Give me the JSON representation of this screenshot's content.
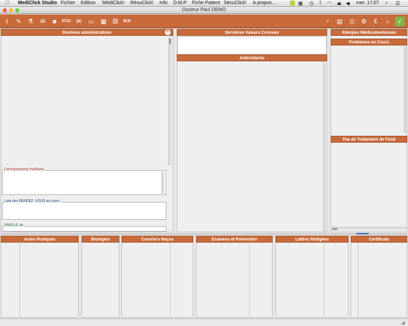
{
  "menubar": {
    "app_name": "MediClick Studio",
    "items": [
      "Fichier",
      "Edition",
      "MédiClick!",
      "RésuClick!",
      "Info",
      "D.M.P",
      "Fiche Patient",
      "SécuClick!",
      "A propos..."
    ],
    "clock": "mer. 17:07"
  },
  "window": {
    "title": "Docteur Paul DEMO"
  },
  "toolbar": {
    "atcd_label": "ATCD",
    "bcb_label": "BCB"
  },
  "left_panel": {
    "header": "Données administratives",
    "correspondants_label": "Correspondants Habituels",
    "rdv_label": "Liste des RENDEZ- VOUS en cours :",
    "famille_label": "FAMILLE de"
  },
  "middle_panel": {
    "dernieres_valeurs": "Dernières Valeurs Connues",
    "antecedents": "Antécédents"
  },
  "right_panel": {
    "allergies": "Allergies Médicamenteuses",
    "problemes": "Problèmes en Cours",
    "traitement": "Pas de Traitement de Fond"
  },
  "bottom_tabs": [
    "Actes Pratiqués",
    "Biologies",
    "Courriers Reçus",
    "Examens et Prévention",
    "Lettres Rédigées",
    "Certificats"
  ],
  "colors": {
    "accent": "#c86a3a",
    "panel_bg": "#efefef",
    "red_label": "#a33",
    "blue_label": "#247",
    "green_label": "#2a7a3a"
  }
}
